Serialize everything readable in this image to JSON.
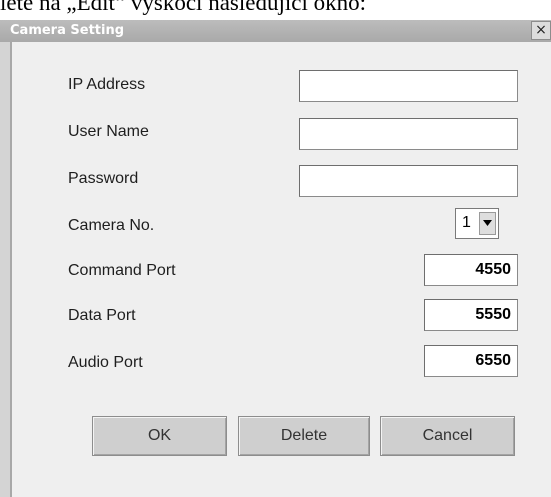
{
  "doc_caption": "lete na „Edit“ vyskočí následující okno:",
  "window": {
    "title": "Camera Setting",
    "close_glyph": "×"
  },
  "fields": {
    "ip_label": "IP Address",
    "ip_value": "",
    "user_label": "User Name",
    "user_value": "",
    "password_label": "Password",
    "password_value": "",
    "camera_label": "Camera No.",
    "camera_value": "1",
    "command_port_label": "Command Port",
    "command_port_value": "4550",
    "data_port_label": "Data Port",
    "data_port_value": "5550",
    "audio_port_label": "Audio Port",
    "audio_port_value": "6550"
  },
  "buttons": {
    "ok": "OK",
    "delete": "Delete",
    "cancel": "Cancel"
  },
  "icons": {
    "close": "close-icon",
    "dropdown": "dropdown-arrow-icon"
  }
}
